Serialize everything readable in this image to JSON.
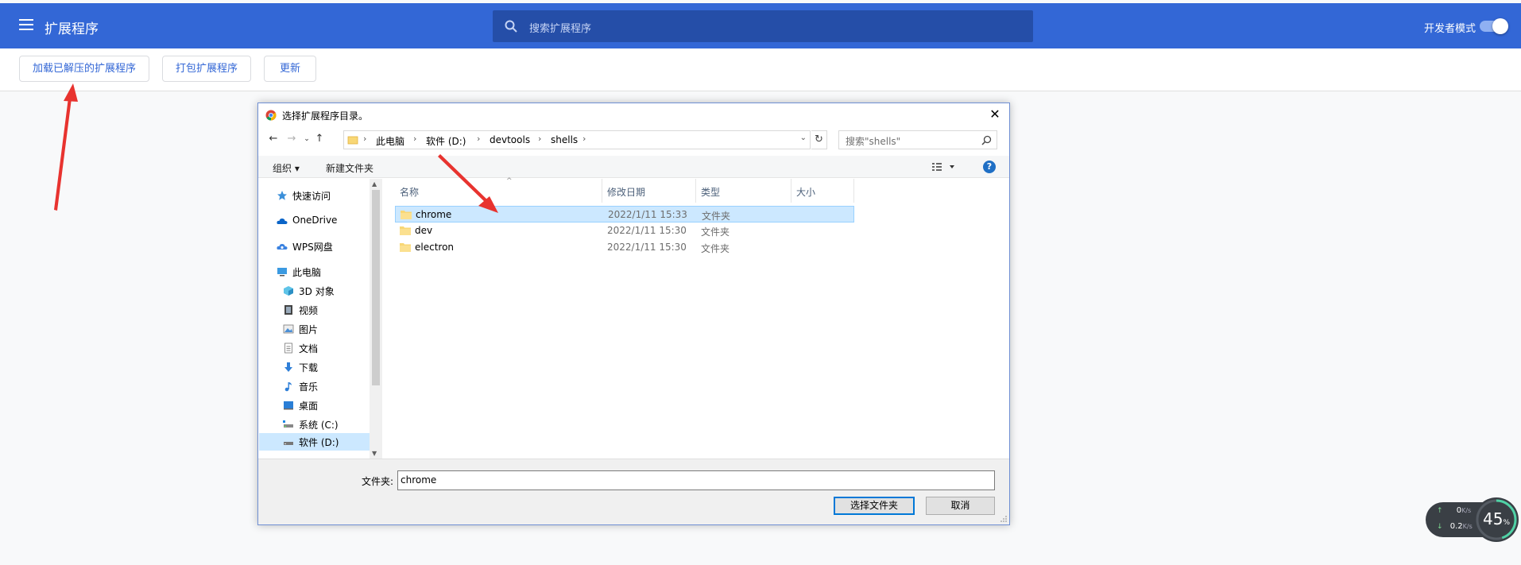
{
  "header": {
    "title": "扩展程序",
    "search_placeholder": "搜索扩展程序",
    "dev_mode_label": "开发者模式",
    "dev_mode_on": true
  },
  "toolbar": {
    "load_unpacked": "加载已解压的扩展程序",
    "pack": "打包扩展程序",
    "update": "更新"
  },
  "dialog": {
    "title": "选择扩展程序目录。",
    "breadcrumbs": [
      "此电脑",
      "软件 (D:)",
      "devtools",
      "shells"
    ],
    "search_placeholder": "搜索\"shells\"",
    "organize": "组织 ▾",
    "new_folder": "新建文件夹",
    "nav_items": [
      {
        "label": "快速访问",
        "icon": "star-icon"
      },
      {
        "label": "OneDrive",
        "icon": "cloud-icon"
      },
      {
        "label": "WPS网盘",
        "icon": "cloud-drive-icon"
      },
      {
        "label": "此电脑",
        "icon": "computer-icon"
      },
      {
        "label": "3D 对象",
        "icon": "cube-icon"
      },
      {
        "label": "视频",
        "icon": "film-icon"
      },
      {
        "label": "图片",
        "icon": "picture-icon"
      },
      {
        "label": "文档",
        "icon": "document-icon"
      },
      {
        "label": "下载",
        "icon": "download-icon"
      },
      {
        "label": "音乐",
        "icon": "music-icon"
      },
      {
        "label": "桌面",
        "icon": "desktop-icon"
      },
      {
        "label": "系统 (C:)",
        "icon": "drive-icon"
      },
      {
        "label": "软件 (D:)",
        "icon": "drive-icon"
      }
    ],
    "columns": [
      "名称",
      "修改日期",
      "类型",
      "大小"
    ],
    "files": [
      {
        "name": "chrome",
        "date": "2022/1/11 15:33",
        "type": "文件夹"
      },
      {
        "name": "dev",
        "date": "2022/1/11 15:30",
        "type": "文件夹"
      },
      {
        "name": "electron",
        "date": "2022/1/11 15:30",
        "type": "文件夹"
      }
    ],
    "folder_label": "文件夹:",
    "folder_value": "chrome",
    "select_button": "选择文件夹",
    "cancel_button": "取消"
  },
  "network": {
    "upload": "0",
    "upload_unit": "K/s",
    "download": "0.2",
    "download_unit": "K/s",
    "percent": "45",
    "percent_unit": "%"
  },
  "colors": {
    "header_bg": "#3367d6",
    "search_bg": "#254ea8",
    "accent": "#3367d6",
    "annotation": "#e8332f",
    "selection": "#cce8ff"
  }
}
